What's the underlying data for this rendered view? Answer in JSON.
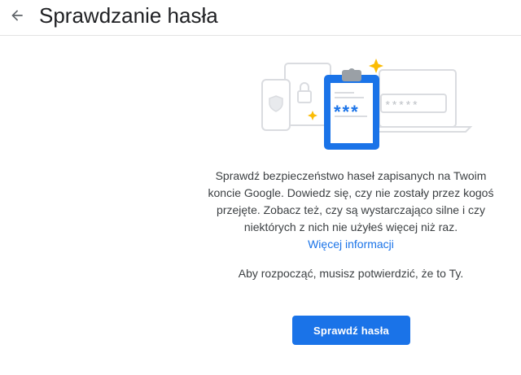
{
  "header": {
    "title": "Sprawdzanie hasła",
    "back_icon": "arrow-back-icon"
  },
  "illustration": {
    "mask_text": "***",
    "dots_text": "*****",
    "icons": [
      "phone-shield-icon",
      "laptop-lock-icon",
      "clipboard-icon",
      "sparkle-icon"
    ],
    "colors": {
      "accent": "#1a73e8",
      "sparkle": "#fbbc04",
      "outline": "#dadce0"
    }
  },
  "content": {
    "description": "Sprawdź bezpieczeństwo haseł zapisanych na Twoim koncie Google. Dowiedz się, czy nie zostały przez kogoś przejęte. Zobacz też, czy są wystarczająco silne i czy niektórych z nich nie użyłeś więcej niż raz.",
    "learn_more": "Więcej informacji",
    "confirm_text": "Aby rozpocząć, musisz potwierdzić, że to Ty."
  },
  "cta": {
    "label": "Sprawdź hasła",
    "color": "#1a73e8"
  }
}
